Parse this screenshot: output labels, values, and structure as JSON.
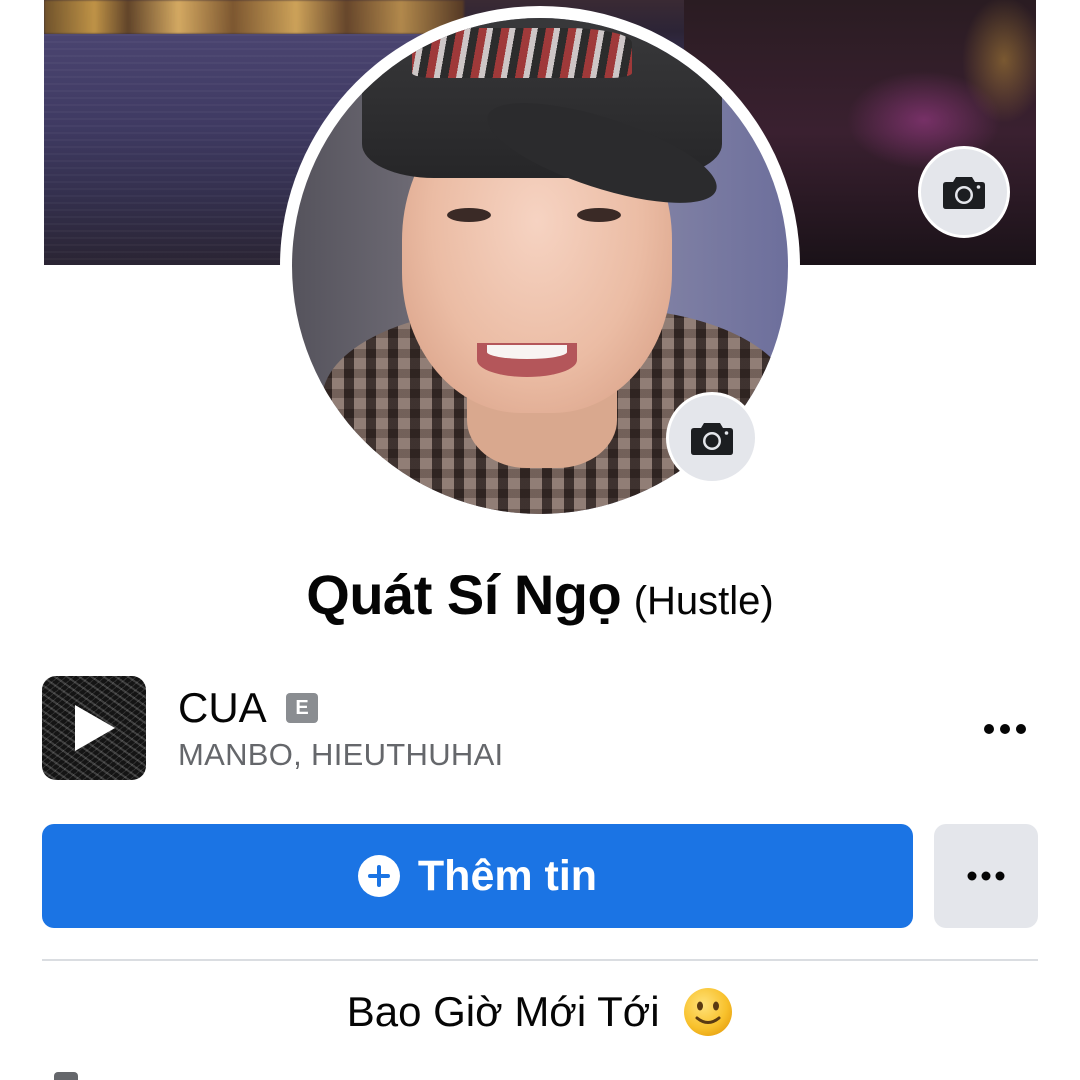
{
  "profile": {
    "name": "Quát Sí Ngọ",
    "alternate_name": "(Hustle)",
    "bio": "Bao Giờ Mới Tới"
  },
  "music": {
    "title": "CUA",
    "explicit_badge": "E",
    "artists": "MANBO, HIEUTHUHAI"
  },
  "actions": {
    "add_story_label": "Thêm tin"
  },
  "icons": {
    "cover_camera": "camera-icon",
    "avatar_camera": "camera-icon",
    "album_play": "play-icon",
    "music_more": "more-horizontal-icon",
    "add_story": "plus-circle-icon",
    "profile_more": "more-horizontal-icon",
    "bio_emoji": "slightly-smiling-face-icon"
  },
  "colors": {
    "primary_blue": "#1b74e4",
    "secondary_button": "#e4e6eb",
    "text_primary": "#050505",
    "text_secondary": "#65676b",
    "explicit_badge": "#8a8d91",
    "divider": "#dadde1"
  }
}
